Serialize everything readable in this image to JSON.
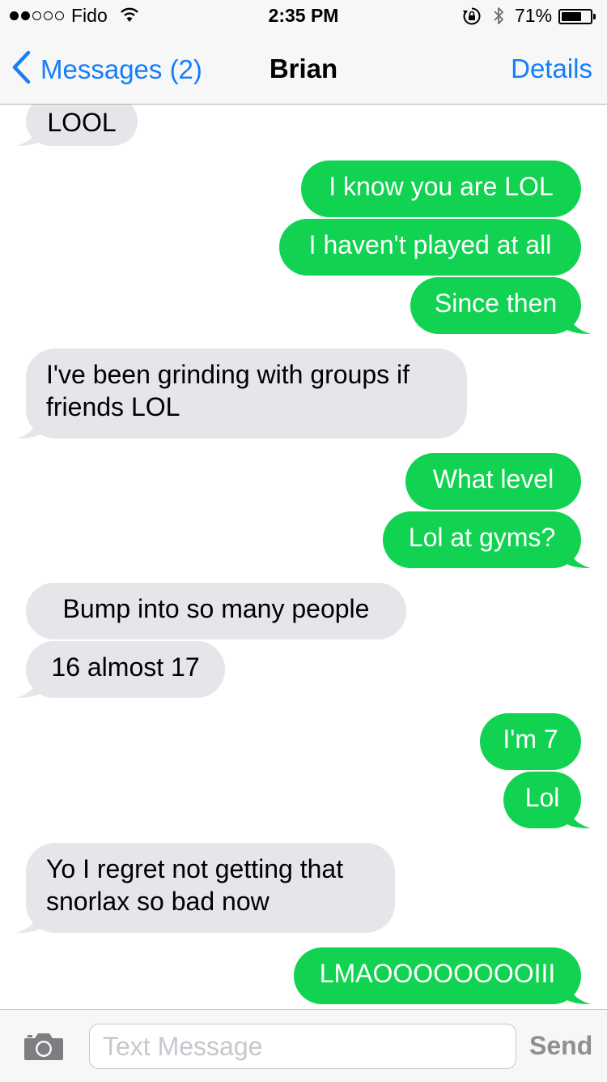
{
  "status_bar": {
    "carrier": "Fido",
    "signal_bars_filled": 2,
    "signal_bars_total": 5,
    "time": "2:35 PM",
    "battery_percent": "71%",
    "battery_level": 0.71
  },
  "nav": {
    "back_label": "Messages (2)",
    "title": "Brian",
    "details_label": "Details"
  },
  "messages": [
    {
      "from": "them",
      "text": "LOOL"
    },
    {
      "from": "me",
      "text": "I know you are LOL"
    },
    {
      "from": "me",
      "text": "I haven't played at all"
    },
    {
      "from": "me",
      "text": "Since then"
    },
    {
      "from": "them",
      "text": "I've been grinding with groups if friends LOL"
    },
    {
      "from": "me",
      "text": "What level"
    },
    {
      "from": "me",
      "text": "Lol at gyms?"
    },
    {
      "from": "them",
      "text": "Bump into so many people"
    },
    {
      "from": "them",
      "text": "16 almost 17"
    },
    {
      "from": "me",
      "text": "I'm 7"
    },
    {
      "from": "me",
      "text": "Lol"
    },
    {
      "from": "them",
      "text": "Yo I regret not getting that snorlax so bad now"
    },
    {
      "from": "me",
      "text": "LMAOOOOOOOOIII"
    }
  ],
  "input_bar": {
    "placeholder": "Text Message",
    "value": "",
    "send_label": "Send"
  },
  "colors": {
    "sent_bubble": "#12d351",
    "received_bubble": "#e5e5ea",
    "accent": "#147efb"
  },
  "icons": [
    "chevron-left-icon",
    "wifi-icon",
    "rotation-lock-icon",
    "bluetooth-icon",
    "battery-icon",
    "camera-icon"
  ]
}
